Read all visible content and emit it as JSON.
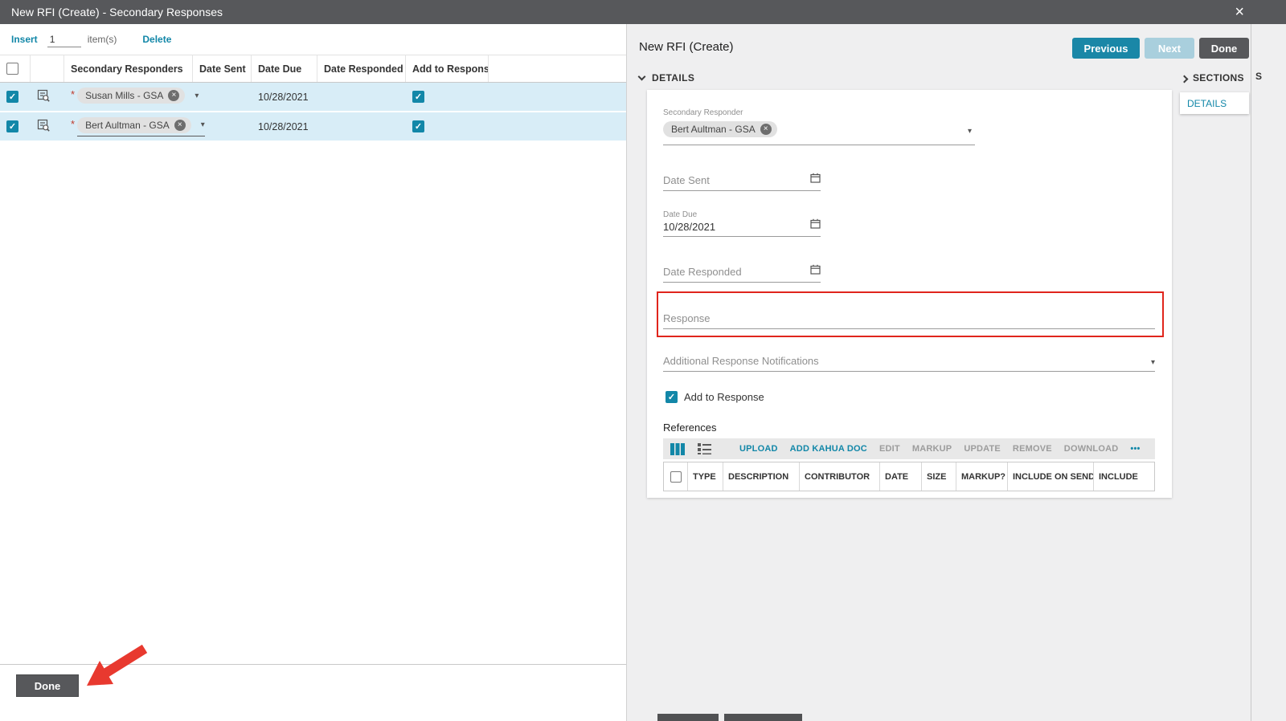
{
  "colors": {
    "accent_teal": "#1287a8",
    "titlebar_gray": "#57585b",
    "row_highlight": "#d8edf7",
    "disabled_teal": "#a9cfdd",
    "annotation_red": "#e0251c"
  },
  "icons": {
    "close": "×",
    "remove_chip": "×",
    "dropdown": "▾",
    "check": "✓",
    "required": "*"
  },
  "titlebar": {
    "title": "New RFI (Create) - Secondary Responses"
  },
  "left_panel": {
    "toolbar": {
      "insert": "Insert",
      "count": "1",
      "items": "item(s)",
      "delete": "Delete"
    },
    "table": {
      "headers": {
        "responders": "Secondary Responders",
        "date_sent": "Date Sent",
        "date_due": "Date Due",
        "date_responded": "Date Responded",
        "add_to_response": "Add to Response"
      },
      "rows": [
        {
          "responder": "Susan Mills - GSA",
          "date_due": "10/28/2021",
          "add_to_response": true
        },
        {
          "responder": "Bert Aultman - GSA",
          "date_due": "10/28/2021",
          "add_to_response": true
        }
      ]
    },
    "done": "Done"
  },
  "right_panel": {
    "title": "New RFI (Create)",
    "buttons": {
      "previous": "Previous",
      "next": "Next",
      "done": "Done"
    },
    "details_header": "DETAILS",
    "sections": {
      "header": "SECTIONS",
      "items": [
        "DETAILS"
      ]
    },
    "edge_text": "S",
    "form": {
      "secondary_responder": {
        "label": "Secondary Responder",
        "value": "Bert Aultman - GSA"
      },
      "date_sent": {
        "placeholder": "Date Sent"
      },
      "date_due": {
        "label": "Date Due",
        "value": "10/28/2021"
      },
      "date_responded": {
        "placeholder": "Date Responded"
      },
      "response": {
        "placeholder": "Response"
      },
      "additional_notifications": {
        "placeholder": "Additional Response Notifications"
      },
      "add_to_response": {
        "label": "Add to Response",
        "checked": true
      },
      "references": {
        "label": "References",
        "toolbar": [
          {
            "label": "UPLOAD",
            "enabled": true
          },
          {
            "label": "ADD KAHUA DOC",
            "enabled": true
          },
          {
            "label": "EDIT",
            "enabled": false
          },
          {
            "label": "MARKUP",
            "enabled": false
          },
          {
            "label": "UPDATE",
            "enabled": false
          },
          {
            "label": "REMOVE",
            "enabled": false
          },
          {
            "label": "DOWNLOAD",
            "enabled": false
          },
          {
            "label": "•••",
            "enabled": true
          }
        ],
        "headers": [
          "TYPE",
          "DESCRIPTION",
          "CONTRIBUTOR",
          "DATE",
          "SIZE",
          "MARKUP?",
          "INCLUDE ON SEND",
          "INCLUDE"
        ]
      }
    }
  }
}
